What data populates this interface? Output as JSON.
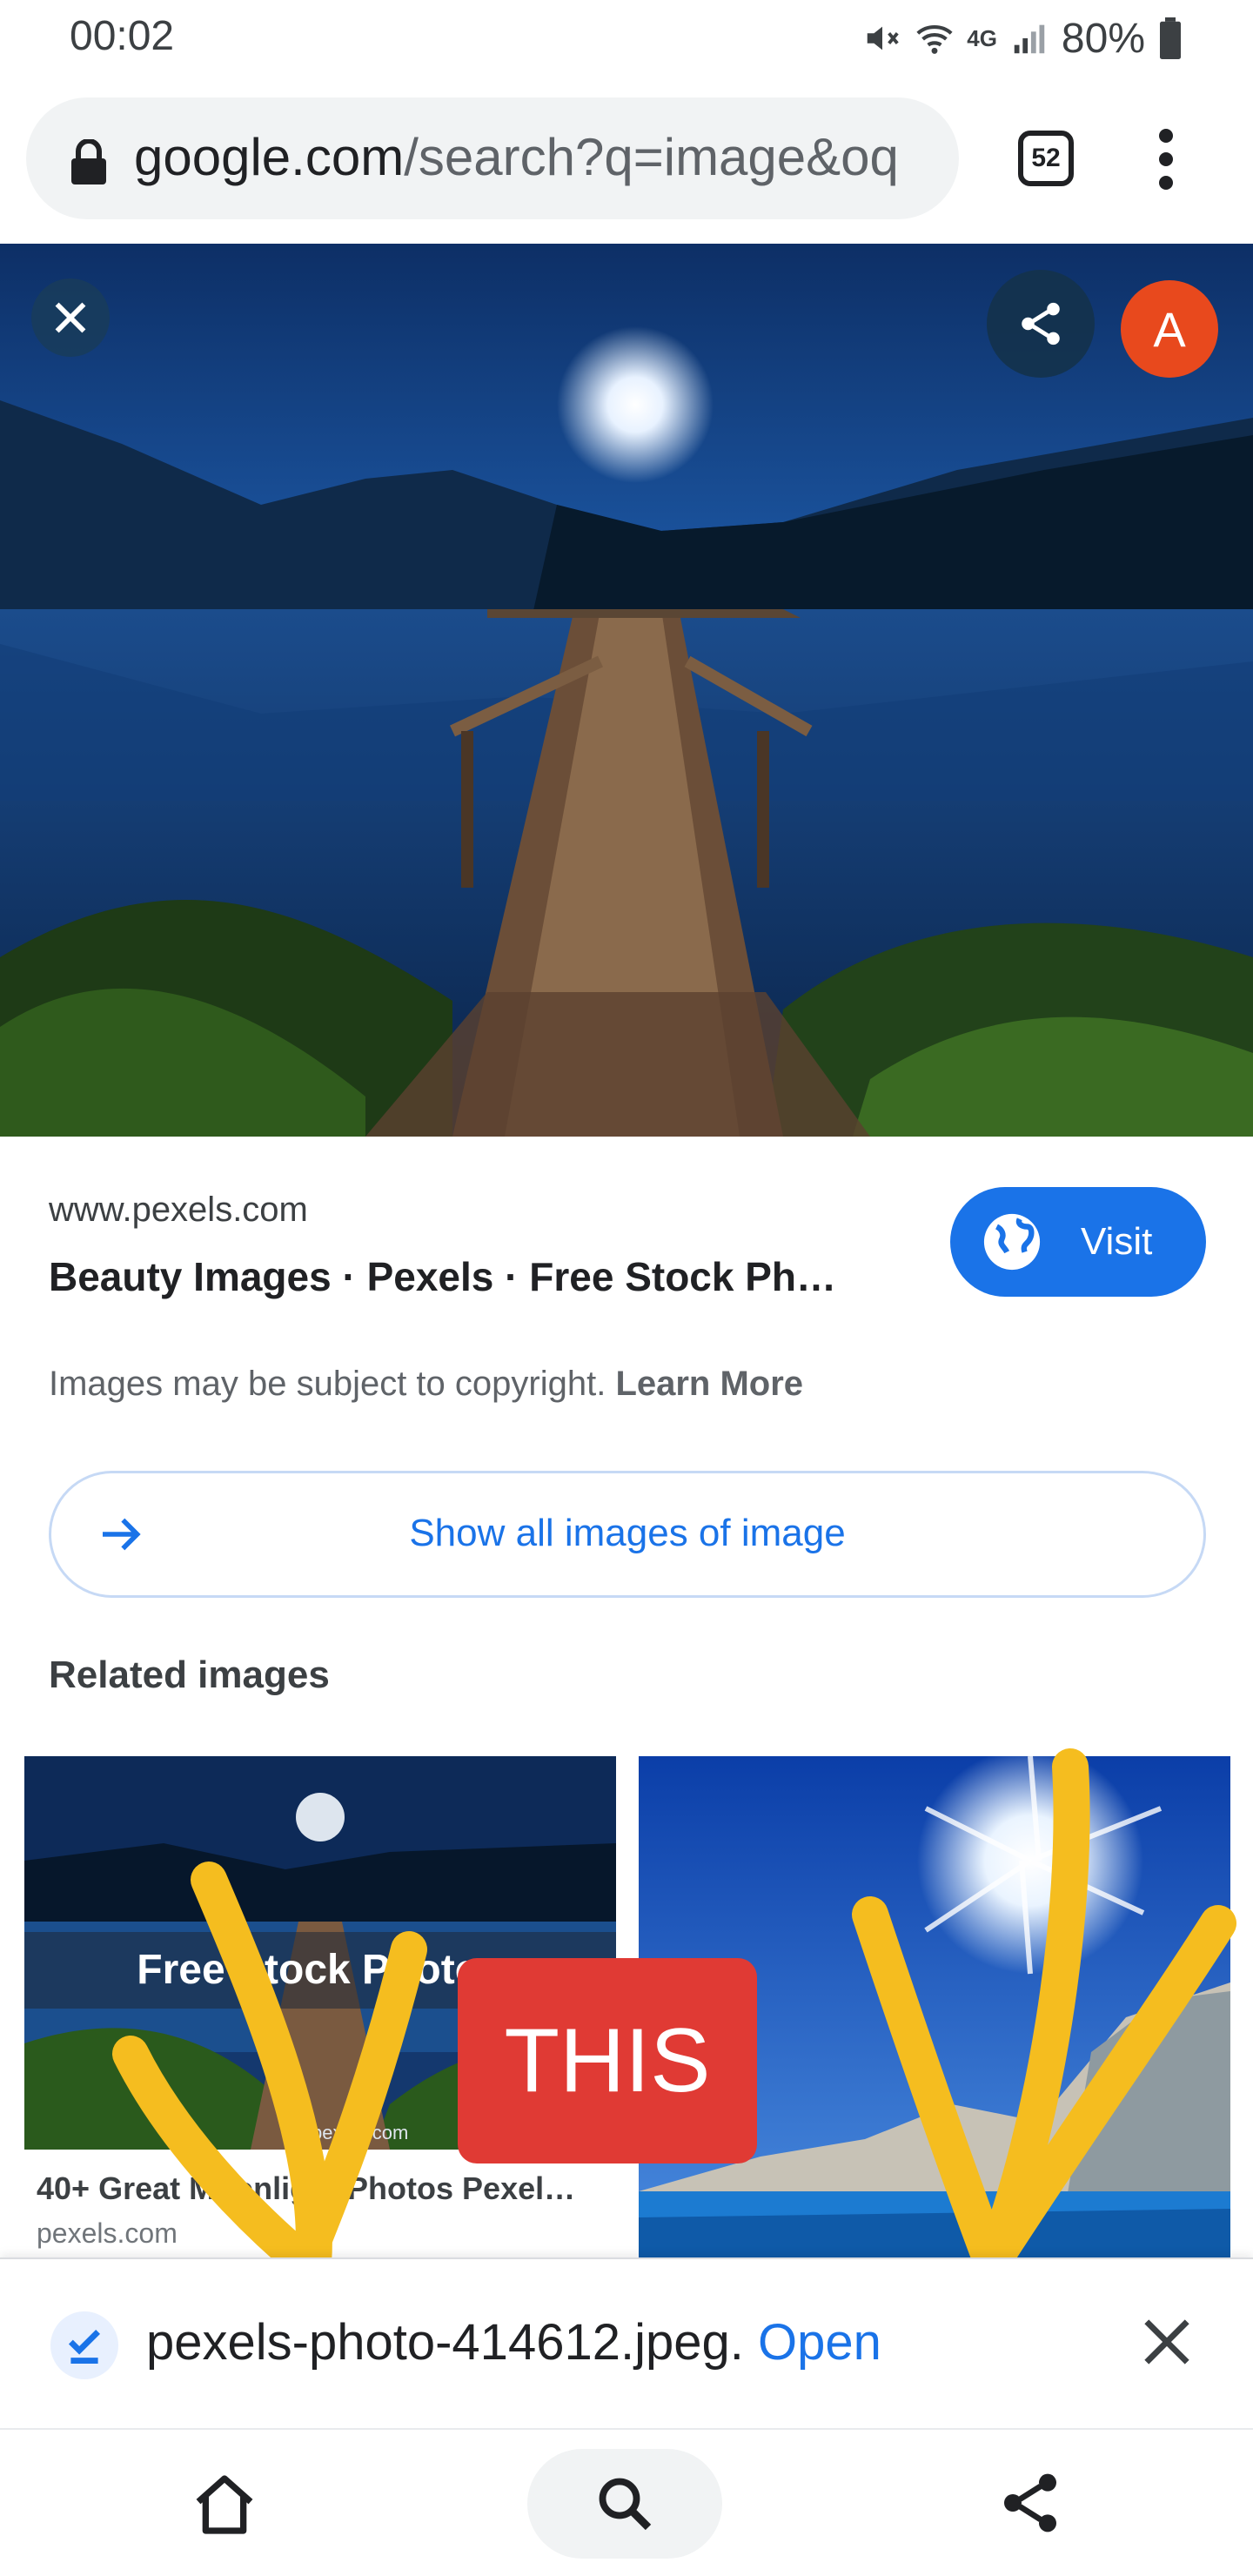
{
  "status_bar": {
    "time": "00:02",
    "network": "4G",
    "battery": "80%"
  },
  "browser": {
    "url_host": "google.com",
    "url_path": "/search?q=image&oq",
    "tab_count": "52"
  },
  "viewer": {
    "avatar_letter": "A",
    "source_domain": "www.pexels.com",
    "title": "Beauty Images · Pexels · Free Stock Ph…",
    "visit_label": "Visit",
    "copyright_text": "Images may be subject to copyright.",
    "learn_more": "Learn More",
    "show_all_label": "Show all images of image",
    "related_heading": "Related images"
  },
  "related": [
    {
      "overlay_text": "Free Stock Photos",
      "watermark": "pexels.com",
      "title": "40+ Great Moonlight Photos Pexel…",
      "source": "pexels.com"
    },
    {
      "overlay_text": "",
      "title": "",
      "source": ""
    }
  ],
  "annotation": {
    "label": "THIS",
    "arrow_color": "#f5bd1f",
    "label_bg": "#e03a34"
  },
  "download": {
    "filename": "pexels-photo-414612.jpeg.",
    "open_label": "Open"
  },
  "icons": {
    "status": [
      "mute-icon",
      "wifi-icon",
      "signal-icon",
      "battery-icon"
    ],
    "toolbar": [
      "lock-icon",
      "tabs-icon",
      "more-icon"
    ],
    "nav": [
      "home-icon",
      "search-icon",
      "share-icon"
    ]
  },
  "colors": {
    "accent": "#1a73e8",
    "avatar": "#e8491d"
  }
}
